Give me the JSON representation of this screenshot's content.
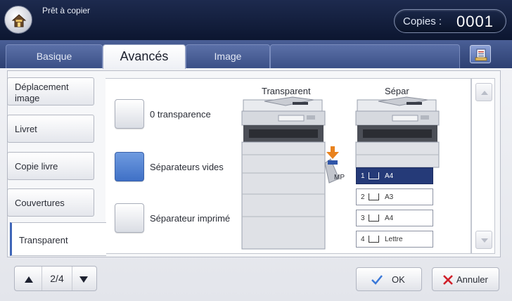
{
  "header": {
    "status": "Prêt à copier",
    "copies_label": "Copies :",
    "copies_value": "0001"
  },
  "tabs": [
    {
      "label": "Basique",
      "active": false
    },
    {
      "label": "Avancés",
      "active": true
    },
    {
      "label": "Image",
      "active": false
    },
    {
      "label": "",
      "active": false
    }
  ],
  "sidebar": {
    "items": [
      {
        "label_line1": "Déplacement",
        "label_line2": "image"
      },
      {
        "label_line1": "Livret",
        "label_line2": ""
      },
      {
        "label_line1": "Copie livre",
        "label_line2": ""
      },
      {
        "label_line1": "Couvertures",
        "label_line2": ""
      },
      {
        "label_line1": "Transparent",
        "label_line2": "",
        "active": true
      }
    ]
  },
  "options": [
    {
      "label": "0 transparence",
      "selected": false
    },
    {
      "label": "Séparateurs vides",
      "selected": true
    },
    {
      "label": "Séparateur imprimé",
      "selected": false
    }
  ],
  "preview": {
    "left_title": "Transparent",
    "right_title": "Sépar",
    "mp_label": "MP",
    "trays": [
      {
        "num": "1",
        "size": "A4",
        "selected": true
      },
      {
        "num": "2",
        "size": "A3",
        "selected": false
      },
      {
        "num": "3",
        "size": "A4",
        "selected": false
      },
      {
        "num": "4",
        "size": "Lettre",
        "selected": false
      }
    ]
  },
  "footer": {
    "page": "2/4",
    "ok_label": "OK",
    "cancel_label": "Annuler"
  },
  "colors": {
    "accent": "#3f70c6",
    "header": "#0c1630",
    "tray_selected": "#253a78",
    "cancel_x": "#d0202a",
    "ok_check": "#3a78d8"
  },
  "icons": {
    "home": "home-icon",
    "tab_action": "document-list-icon",
    "ok": "check-icon",
    "cancel": "x-icon"
  }
}
